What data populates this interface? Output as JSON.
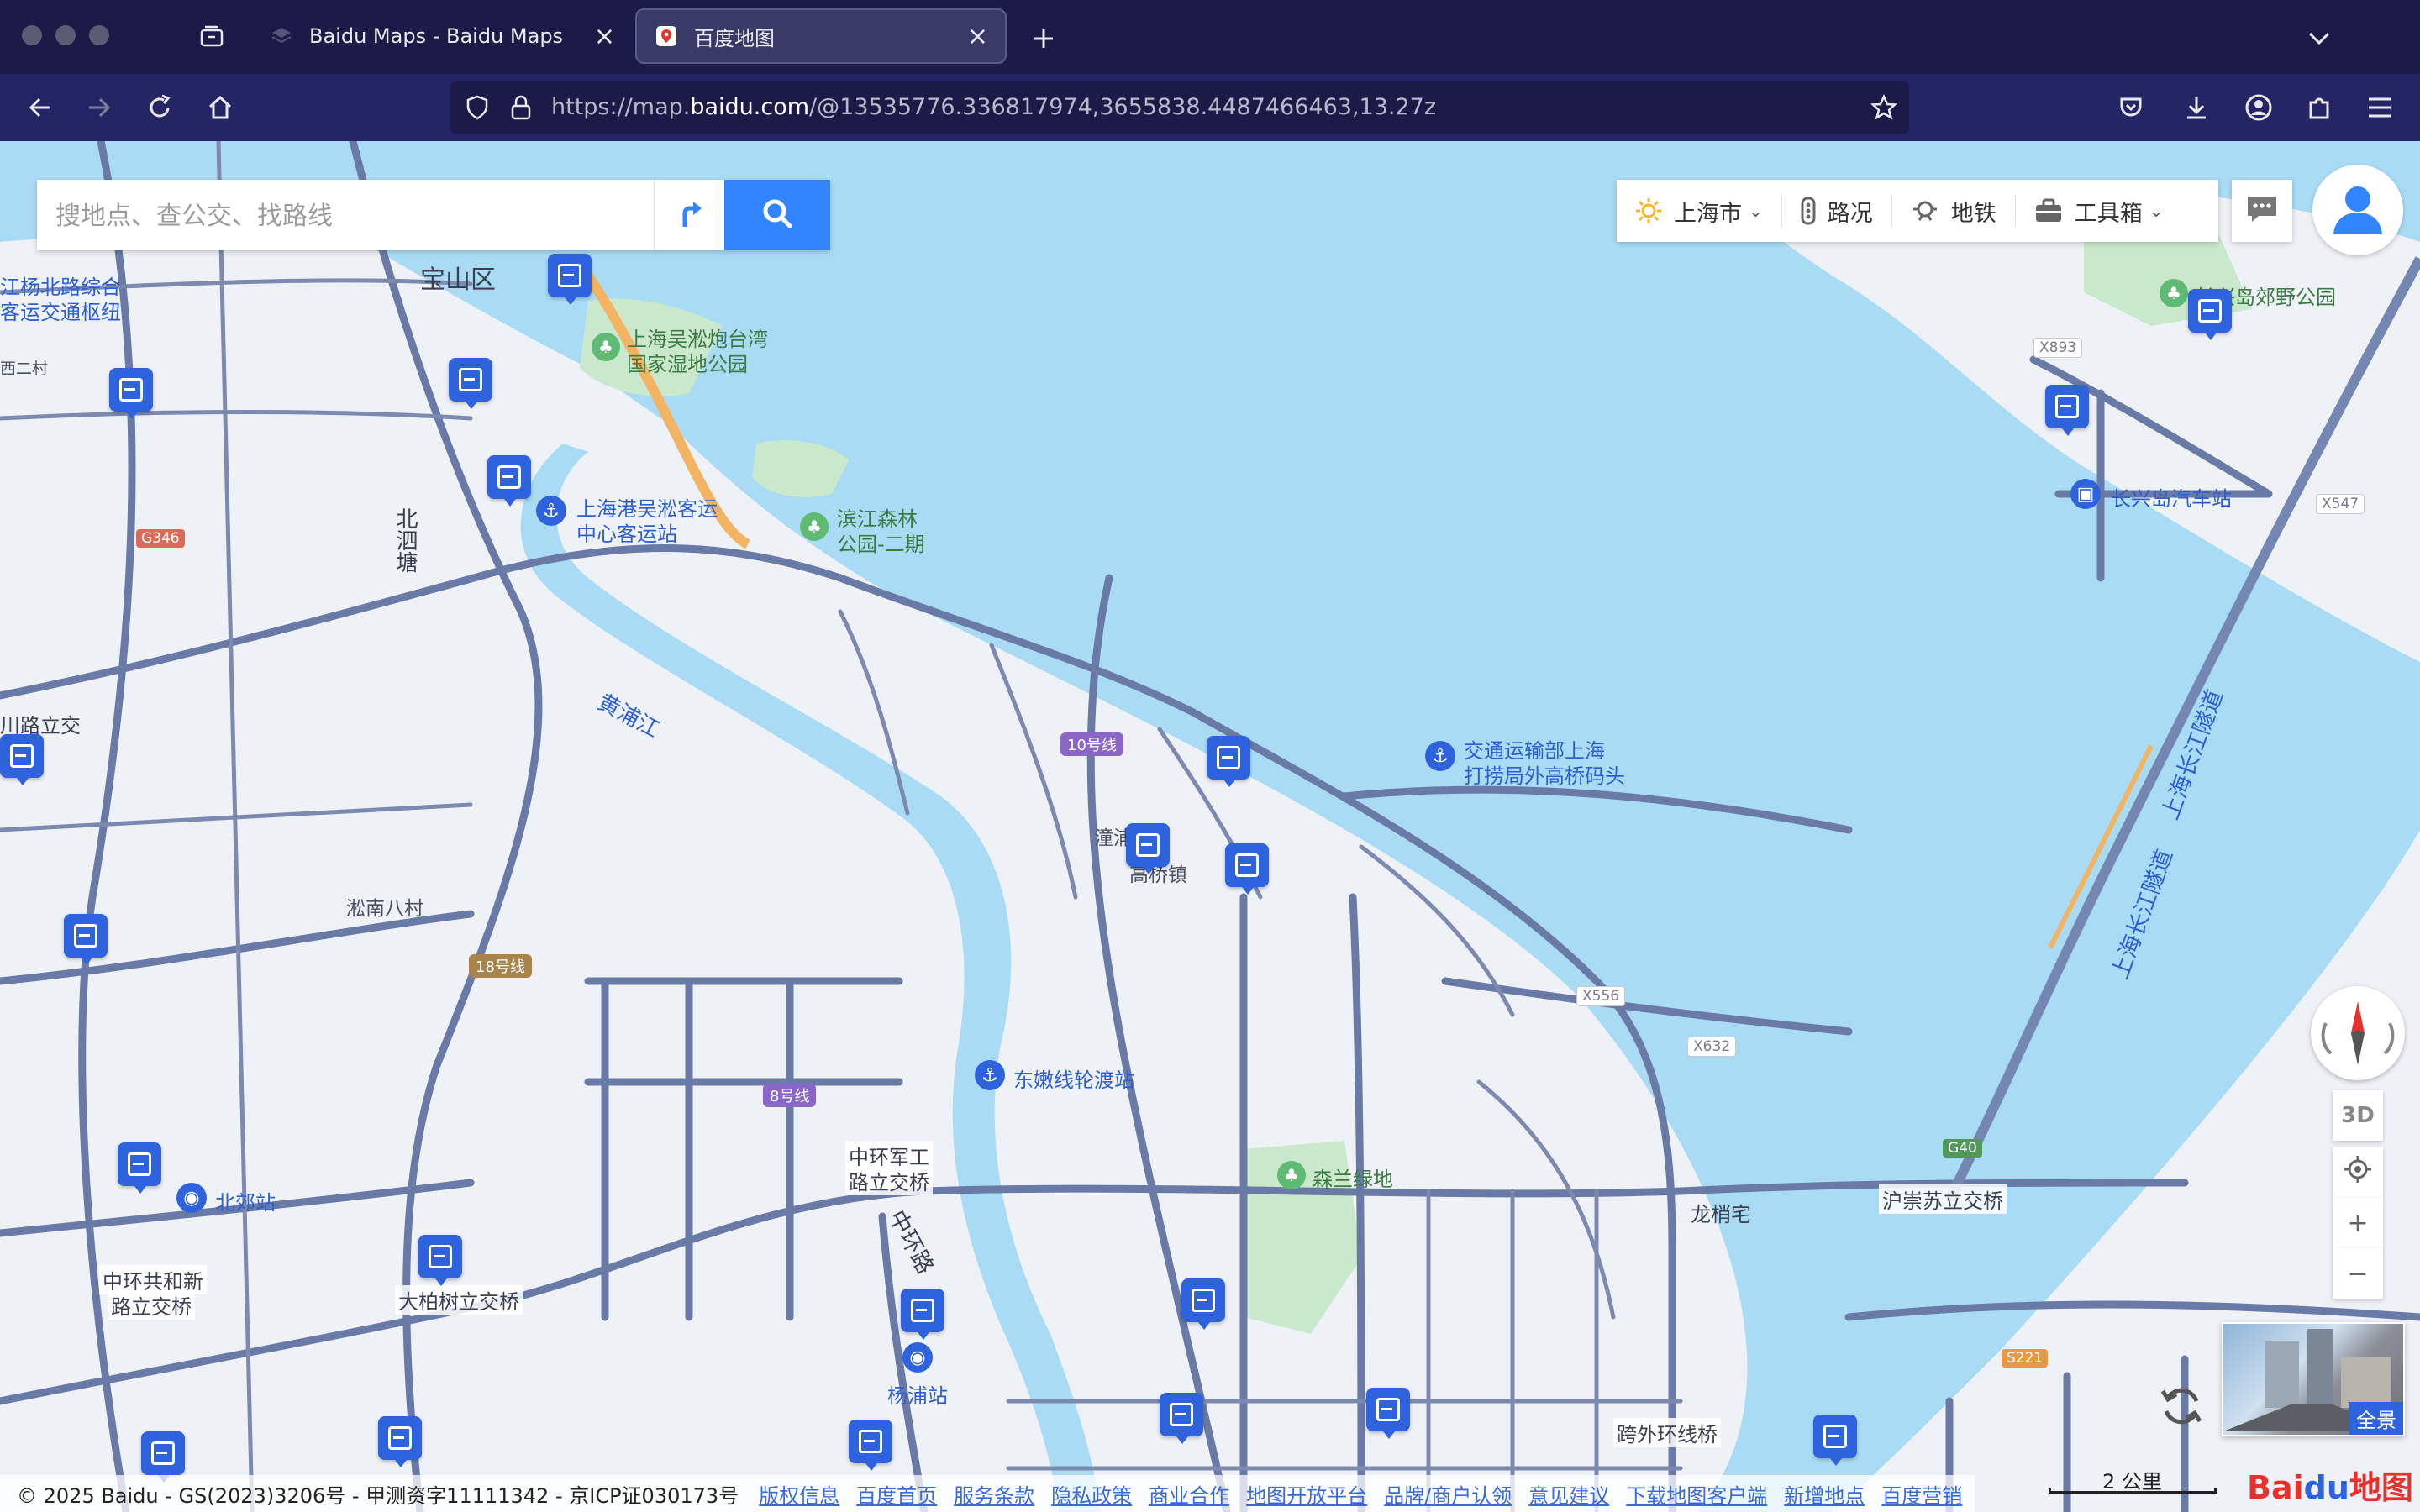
{
  "browser": {
    "tabs": [
      {
        "title": "Baidu Maps - Baidu Maps",
        "active": false
      },
      {
        "title": "百度地图",
        "active": true
      }
    ],
    "url_prefix": "https://map.",
    "url_domain": "baidu.com",
    "url_suffix": "/@13535776.336817974,3655838.4487466463,13.27z"
  },
  "search": {
    "placeholder": "搜地点、查公交、找路线"
  },
  "toolbar": {
    "city": "上海市",
    "traffic": "路况",
    "subway": "地铁",
    "toolbox": "工具箱"
  },
  "map": {
    "labels": {
      "baoshan": "宝山区",
      "jiangyang": "江杨北路综合",
      "keyun": "客运交通枢纽",
      "xier": "西二村",
      "wusong_park1": "上海吴淞炮台湾",
      "wusong_park2": "国家湿地公园",
      "port1": "上海港吴淞客运",
      "port2": "中心客运站",
      "binjiang1": "滨江森林",
      "binjiang2": "公园-二期",
      "beisitang": "北泗塘",
      "huangpu": "黄浦江",
      "chuan": "川路立交",
      "songnan": "淞南八村",
      "pier1": "交通运输部上海",
      "pier2": "打捞局外高桥码头",
      "gaoqiao_a": "潼浦",
      "gaoqiao_b": "高桥镇",
      "ferry": "东嫩线轮渡站",
      "zhonghuan1": "中环军工",
      "zhonghuan2": "路立交桥",
      "zhonghuanlu": "中环路",
      "senlan": "森兰绿地",
      "longshao": "龙梢宅",
      "huchong": "沪崇苏立交桥",
      "beijiao": "北郊站",
      "gongheN1": "中环共和新",
      "gongheN2": "路立交桥",
      "dabaishu": "大柏树立交桥",
      "yangpu": "杨浦站",
      "kuawai": "跨外环线桥",
      "changxing_park": "长兴岛郊野公园",
      "changxing_bus": "长兴岛汽车站",
      "tunnel": "上海长江隧道",
      "tunnel2": "上海长江隧道"
    },
    "subway_badges": [
      "10号线",
      "18号线",
      "8号线"
    ],
    "road_numbers": [
      "G346",
      "X893",
      "X547",
      "X556",
      "X632",
      "G40",
      "S221"
    ]
  },
  "controls": {
    "three_d": "3D",
    "zoom_in": "+",
    "zoom_out": "−",
    "panorama": "全景"
  },
  "footer": {
    "copyright": "© 2025 Baidu - GS(2023)3206号 - 甲测资字11111342 - 京ICP证030173号",
    "links": [
      "版权信息",
      "百度首页",
      "服务条款",
      "隐私政策",
      "商业合作",
      "地图开放平台",
      "品牌/商户认领",
      "意见建议",
      "下载地图客户端",
      "新增地点",
      "百度营销"
    ],
    "scale": "2 公里",
    "logo_a": "Bai",
    "logo_b": "du",
    "logo_c": "地图"
  },
  "colors": {
    "water": "#a9dcf4",
    "road": "#6a7aa6",
    "accent": "#3385ff",
    "park": "#c9e8cc"
  }
}
